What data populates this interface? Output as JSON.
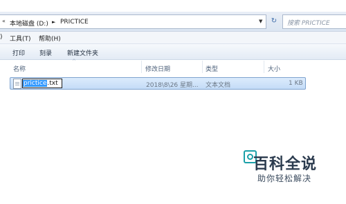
{
  "address": {
    "segments": [
      "本地磁盘 (D:)",
      "PRICTICE"
    ],
    "separator": "►"
  },
  "search": {
    "placeholder": "搜索 PRICTICE"
  },
  "menu": {
    "items": [
      ")",
      "工具(T)",
      "帮助(H)"
    ]
  },
  "toolbar": {
    "items": [
      "打印",
      "刻录",
      "新建文件夹"
    ]
  },
  "columns": {
    "name": "名称",
    "modified": "修改日期",
    "type": "类型",
    "size": "大小"
  },
  "file": {
    "rename_selected": "prictice",
    "rename_ext": ".txt",
    "modified": "2018\\8\\26 星期...",
    "type": "文本文档",
    "size": "1 KB"
  },
  "watermark": {
    "title": "百科全说",
    "subtitle": "助你轻松解决"
  },
  "colors": {
    "selection": "#3399ff",
    "row_highlight": "#cfe3fb",
    "watermark_logo": "#1aa0a8"
  }
}
